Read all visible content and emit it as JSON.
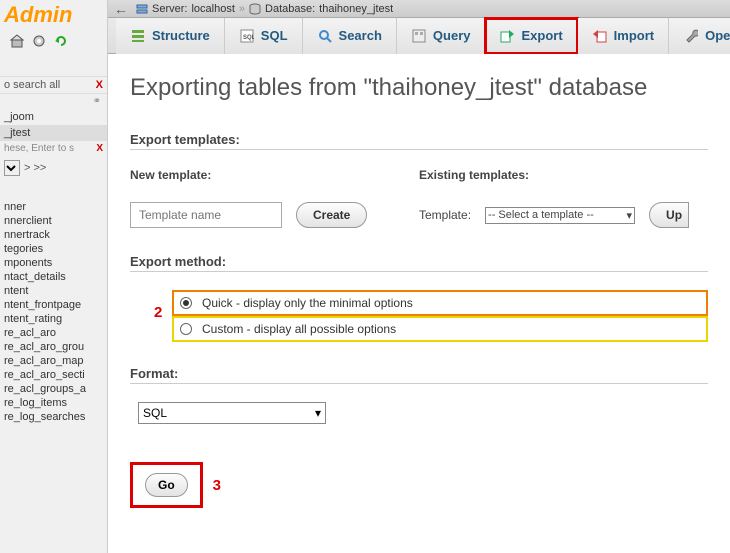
{
  "logo": "Admin",
  "sidebar": {
    "search_all": "o search all",
    "dbs": [
      "_joom",
      "_jtest"
    ],
    "db_search_hint": "hese, Enter to s",
    "nav_more": "> >>",
    "tables": [
      "nner",
      "nnerclient",
      "nnertrack",
      "tegories",
      "mponents",
      "ntact_details",
      "ntent",
      "ntent_frontpage",
      "ntent_rating",
      "re_acl_aro",
      "re_acl_aro_grou",
      "re_acl_aro_map",
      "re_acl_aro_secti",
      "re_acl_groups_a",
      "re_log_items",
      "re_log_searches"
    ]
  },
  "breadcrumb": {
    "server_label": "Server:",
    "server_value": "localhost",
    "db_label": "Database:",
    "db_value": "thaihoney_jtest"
  },
  "tabs": {
    "structure": "Structure",
    "sql": "SQL",
    "search": "Search",
    "query": "Query",
    "export": "Export",
    "import": "Import",
    "operat": "Operat"
  },
  "page_title": "Exporting tables from \"thaihoney_jtest\" database",
  "export_templates_title": "Export templates:",
  "new_template_label": "New template:",
  "template_placeholder": "Template name",
  "create_label": "Create",
  "existing_templates_label": "Existing templates:",
  "template_label": "Template:",
  "template_select": "-- Select a template --",
  "up_label": "Up",
  "export_method_title": "Export method:",
  "quick_label": "Quick - display only the minimal options",
  "custom_label": "Custom - display all possible options",
  "anno2": "2",
  "format_title": "Format:",
  "format_value": "SQL",
  "go_label": "Go",
  "anno3": "3"
}
